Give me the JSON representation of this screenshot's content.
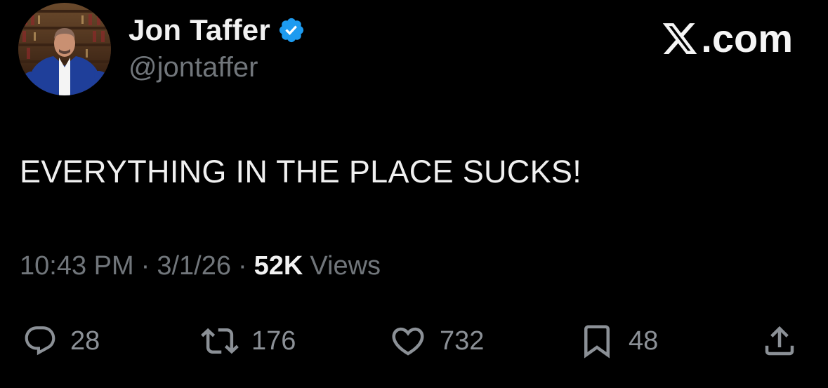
{
  "author": {
    "display_name": "Jon Taffer",
    "handle": "@jontaffer",
    "verified": true
  },
  "brand": {
    "label": ".com"
  },
  "tweet": {
    "text": "EVERYTHING IN THE PLACE SUCKS!",
    "time": "10:43 PM",
    "date": "3/1/26",
    "separator": "·",
    "views_count": "52K",
    "views_label": "Views"
  },
  "actions": {
    "replies": "28",
    "reposts": "176",
    "likes": "732",
    "bookmarks": "48"
  },
  "icons": {
    "reply": "reply-icon",
    "repost": "repost-icon",
    "like": "heart-icon",
    "bookmark": "bookmark-icon",
    "share": "share-icon",
    "verified": "verified-badge-icon",
    "brand": "x-logo-icon"
  },
  "colors": {
    "background": "#000000",
    "text": "#e7e9ea",
    "secondary": "#71767b",
    "verified": "#1d9bf0"
  }
}
